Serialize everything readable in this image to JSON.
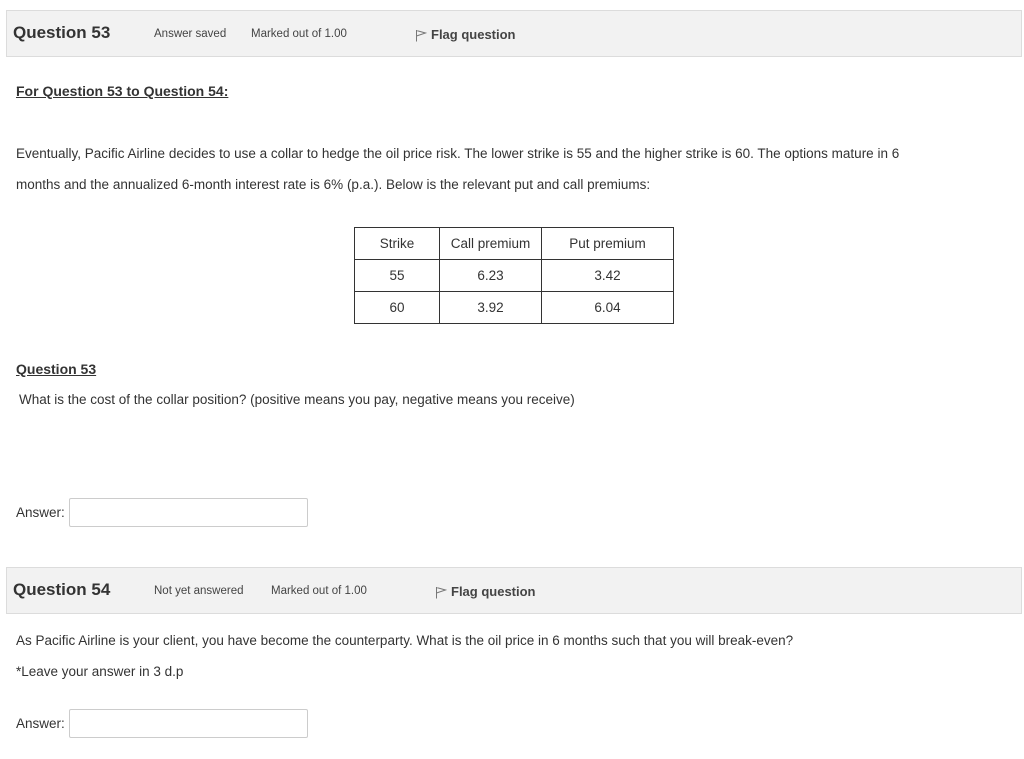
{
  "questions": [
    {
      "number_label": "Question",
      "number": "53",
      "state": "Answer saved",
      "grade": "Marked out of 1.00",
      "flag_label": "Flag question"
    },
    {
      "number_label": "Question",
      "number": "54",
      "state": "Not yet answered",
      "grade": "Marked out of 1.00",
      "flag_label": "Flag question"
    }
  ],
  "intro": {
    "title": "For Question 53 to Question 54:",
    "line1": "Eventually, Pacific Airline decides to use a collar to hedge the oil price risk. The lower strike is 55 and the higher strike is 60. The options mature in 6",
    "line2": "months and the annualized 6-month interest rate is 6% (p.a.). Below is the relevant put and call premiums:"
  },
  "premium_table": {
    "headers": [
      "Strike",
      "Call premium",
      "Put premium"
    ],
    "rows": [
      [
        "55",
        "6.23",
        "3.42"
      ],
      [
        "60",
        "3.92",
        "6.04"
      ]
    ]
  },
  "q53": {
    "subtitle": "Question 53",
    "text": "What is the cost of the collar position? (positive means you pay, negative means you receive)",
    "answer_label": "Answer:",
    "answer_value": ""
  },
  "q54": {
    "text": "As Pacific Airline is your client, you have become the counterparty. What is the oil price in 6 months such that you will break-even?",
    "note": "*Leave your answer in 3 d.p",
    "answer_label": "Answer:",
    "answer_value": ""
  }
}
